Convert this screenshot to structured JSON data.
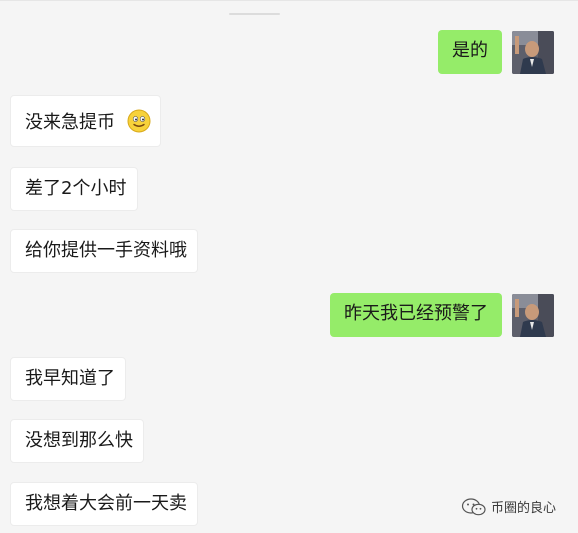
{
  "messages": [
    {
      "side": "right",
      "text": "是的"
    },
    {
      "side": "left",
      "text": "没来急提币",
      "emoji": "smiley-face"
    },
    {
      "side": "left",
      "text": "差了2个小时"
    },
    {
      "side": "left",
      "text": "给你提供一手资料哦"
    },
    {
      "side": "right",
      "text": "昨天我已经预警了"
    },
    {
      "side": "left",
      "text": "我早知道了"
    },
    {
      "side": "left",
      "text": "没想到那么快"
    },
    {
      "side": "left",
      "text": "我想着大会前一天卖"
    }
  ],
  "watermark": {
    "text": "币圈的良心",
    "icon": "wechat-icon"
  },
  "colors": {
    "self_bubble": "#95ec69",
    "other_bubble": "#ffffff",
    "background": "#f5f5f5"
  }
}
